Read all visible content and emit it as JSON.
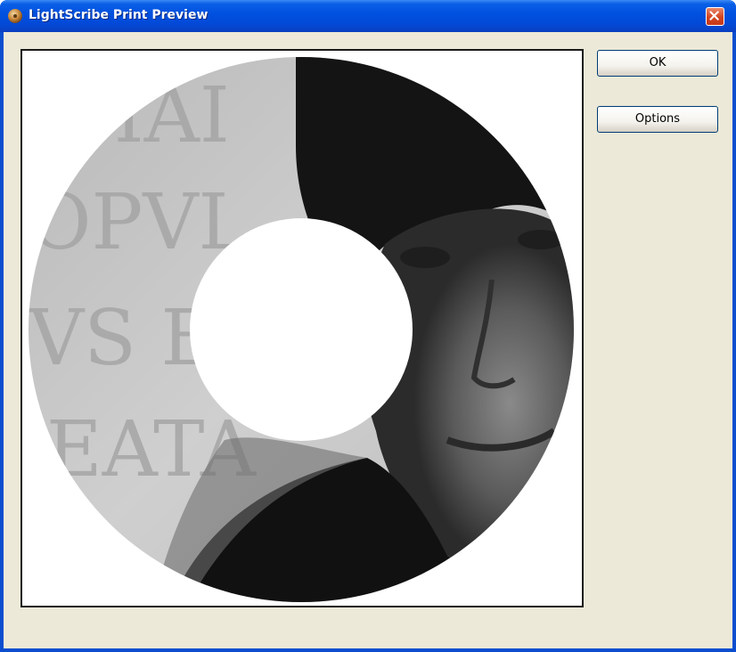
{
  "window": {
    "title": "LightScribe Print Preview",
    "app_icon": "lightscribe-disc-icon",
    "close_icon": "close-icon",
    "accent_color": "#0a4ecf",
    "close_color": "#d4441f"
  },
  "buttons": {
    "ok_label": "OK",
    "options_label": "Options"
  },
  "preview": {
    "content": "disc-label-preview",
    "background_color": "#ffffff"
  }
}
